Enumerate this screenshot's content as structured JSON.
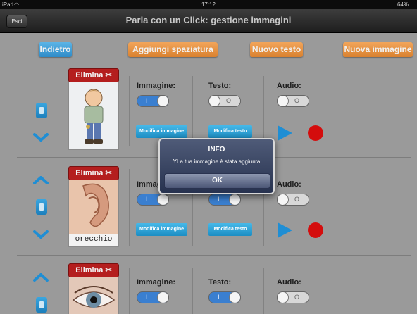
{
  "status_bar": {
    "carrier": "iPad",
    "time": "17:12",
    "battery": "64%"
  },
  "title_bar": {
    "exit_label": "Esci",
    "title": "Parla con un Click: gestione immagini"
  },
  "toolbar": {
    "back_label": "Indietro",
    "add_spacing_label": "Aggiungi spaziatura",
    "new_text_label": "Nuovo testo",
    "new_image_label": "Nuova immagine"
  },
  "labels": {
    "delete": "Elimina",
    "image": "Immagine:",
    "text": "Testo:",
    "audio": "Audio:",
    "edit_image": "Modifica immagine",
    "edit_text": "Modifica testo",
    "toggle_on": "I",
    "toggle_off": "O"
  },
  "rows": [
    {
      "image": "boy",
      "caption": "",
      "image_on": true,
      "text_on": false,
      "audio_on": false
    },
    {
      "image": "ear",
      "caption": "orecchio",
      "image_on": true,
      "text_on": true,
      "audio_on": false
    },
    {
      "image": "eye",
      "caption": "",
      "image_on": false,
      "text_on": true,
      "audio_on": false
    }
  ],
  "dialog": {
    "title": "INFO",
    "message": "YLa tua immagine è stata aggiunta",
    "ok_label": "OK"
  },
  "colors": {
    "accent_blue": "#2e8bc8",
    "accent_orange": "#d9812f",
    "delete_red": "#b41e1e",
    "record_red": "#d40d0d"
  }
}
